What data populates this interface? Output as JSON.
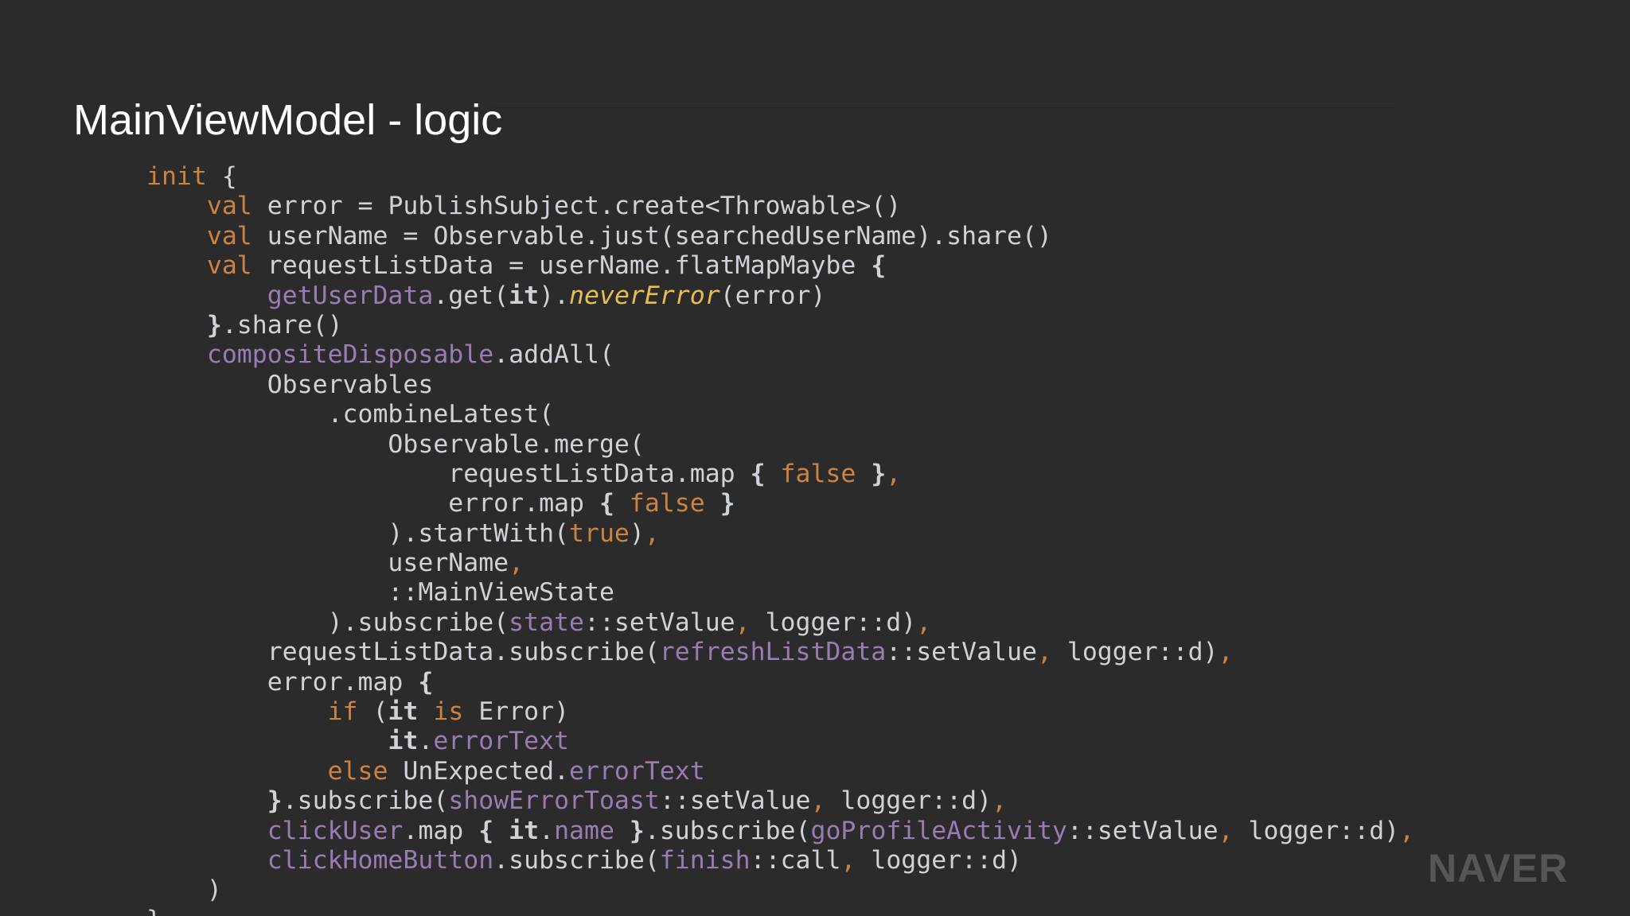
{
  "slide": {
    "title": "MainViewModel - logic",
    "brand": "NAVER"
  },
  "colors": {
    "background": "#2b2b2c",
    "title": "#ffffff",
    "code_default": "#cfd2d6",
    "keyword": "#cc8240",
    "property": "#9a7bb3",
    "italic_fn": "#e8bd53",
    "brand": "#555657"
  },
  "code": {
    "lines": [
      [
        {
          "t": "init",
          "c": "kw"
        },
        {
          "t": " {"
        }
      ],
      [
        {
          "t": "    "
        },
        {
          "t": "val",
          "c": "kw"
        },
        {
          "t": " error = PublishSubject.create<Throwable>()"
        }
      ],
      [
        {
          "t": "    "
        },
        {
          "t": "val",
          "c": "kw"
        },
        {
          "t": " userName = Observable.just(searchedUserName).share()"
        }
      ],
      [
        {
          "t": "    "
        },
        {
          "t": "val",
          "c": "kw"
        },
        {
          "t": " requestListData = userName.flatMapMaybe "
        },
        {
          "t": "{",
          "c": "bold"
        }
      ],
      [
        {
          "t": "        "
        },
        {
          "t": "getUserData",
          "c": "prop"
        },
        {
          "t": ".get("
        },
        {
          "t": "it",
          "c": "bold"
        },
        {
          "t": ")."
        },
        {
          "t": "neverError",
          "c": "ital"
        },
        {
          "t": "(error)"
        }
      ],
      [
        {
          "t": "    "
        },
        {
          "t": "}",
          "c": "bold"
        },
        {
          "t": ".share()"
        }
      ],
      [
        {
          "t": "    "
        },
        {
          "t": "compositeDisposable",
          "c": "prop"
        },
        {
          "t": ".addAll("
        }
      ],
      [
        {
          "t": "        Observables"
        }
      ],
      [
        {
          "t": "            .combineLatest("
        }
      ],
      [
        {
          "t": "                Observable.merge("
        }
      ],
      [
        {
          "t": "                    requestListData.map "
        },
        {
          "t": "{",
          "c": "bold"
        },
        {
          "t": " "
        },
        {
          "t": "false",
          "c": "kw"
        },
        {
          "t": " "
        },
        {
          "t": "}",
          "c": "bold"
        },
        {
          "t": ",",
          "c": "kw"
        }
      ],
      [
        {
          "t": "                    error.map "
        },
        {
          "t": "{",
          "c": "bold"
        },
        {
          "t": " "
        },
        {
          "t": "false",
          "c": "kw"
        },
        {
          "t": " "
        },
        {
          "t": "}",
          "c": "bold"
        }
      ],
      [
        {
          "t": "                ).startWith("
        },
        {
          "t": "true",
          "c": "kw"
        },
        {
          "t": ")"
        },
        {
          "t": ",",
          "c": "kw"
        }
      ],
      [
        {
          "t": "                userName"
        },
        {
          "t": ",",
          "c": "kw"
        }
      ],
      [
        {
          "t": "                ::MainViewState"
        }
      ],
      [
        {
          "t": "            ).subscribe("
        },
        {
          "t": "state",
          "c": "prop"
        },
        {
          "t": "::setValue"
        },
        {
          "t": ",",
          "c": "kw"
        },
        {
          "t": " logger::d)"
        },
        {
          "t": ",",
          "c": "kw"
        }
      ],
      [
        {
          "t": "        requestListData.subscribe("
        },
        {
          "t": "refreshListData",
          "c": "prop"
        },
        {
          "t": "::setValue"
        },
        {
          "t": ",",
          "c": "kw"
        },
        {
          "t": " logger::d)"
        },
        {
          "t": ",",
          "c": "kw"
        }
      ],
      [
        {
          "t": "        error.map "
        },
        {
          "t": "{",
          "c": "bold"
        }
      ],
      [
        {
          "t": "            "
        },
        {
          "t": "if",
          "c": "kw"
        },
        {
          "t": " ("
        },
        {
          "t": "it",
          "c": "bold"
        },
        {
          "t": " "
        },
        {
          "t": "is",
          "c": "kw"
        },
        {
          "t": " Error)"
        }
      ],
      [
        {
          "t": "                "
        },
        {
          "t": "it",
          "c": "bold"
        },
        {
          "t": "."
        },
        {
          "t": "errorText",
          "c": "prop"
        }
      ],
      [
        {
          "t": "            "
        },
        {
          "t": "else",
          "c": "kw"
        },
        {
          "t": " UnExpected."
        },
        {
          "t": "errorText",
          "c": "prop"
        }
      ],
      [
        {
          "t": "        "
        },
        {
          "t": "}",
          "c": "bold"
        },
        {
          "t": ".subscribe("
        },
        {
          "t": "showErrorToast",
          "c": "prop"
        },
        {
          "t": "::setValue"
        },
        {
          "t": ",",
          "c": "kw"
        },
        {
          "t": " logger::d)"
        },
        {
          "t": ",",
          "c": "kw"
        }
      ],
      [
        {
          "t": "        "
        },
        {
          "t": "clickUser",
          "c": "prop"
        },
        {
          "t": ".map "
        },
        {
          "t": "{",
          "c": "bold"
        },
        {
          "t": " "
        },
        {
          "t": "it",
          "c": "bold"
        },
        {
          "t": "."
        },
        {
          "t": "name",
          "c": "prop"
        },
        {
          "t": " "
        },
        {
          "t": "}",
          "c": "bold"
        },
        {
          "t": ".subscribe("
        },
        {
          "t": "goProfileActivity",
          "c": "prop"
        },
        {
          "t": "::setValue"
        },
        {
          "t": ",",
          "c": "kw"
        },
        {
          "t": " logger::d)"
        },
        {
          "t": ",",
          "c": "kw"
        }
      ],
      [
        {
          "t": "        "
        },
        {
          "t": "clickHomeButton",
          "c": "prop"
        },
        {
          "t": ".subscribe("
        },
        {
          "t": "finish",
          "c": "prop"
        },
        {
          "t": "::call"
        },
        {
          "t": ",",
          "c": "kw"
        },
        {
          "t": " logger::d)"
        }
      ],
      [
        {
          "t": "    )"
        }
      ],
      [
        {
          "t": "}"
        }
      ]
    ]
  }
}
